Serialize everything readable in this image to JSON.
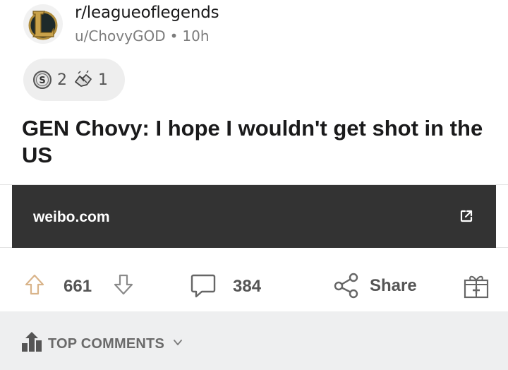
{
  "post": {
    "subreddit": "r/leagueoflegends",
    "author": "u/ChovyGOD",
    "separator": "•",
    "age": "10h",
    "title": "GEN Chovy: I hope I wouldn't get shot in the US",
    "link_domain": "weibo.com"
  },
  "awards": [
    {
      "icon": "silver-award-icon",
      "count": "2"
    },
    {
      "icon": "helpful-hands-award-icon",
      "count": "1"
    }
  ],
  "actions": {
    "score": "661",
    "comments": "384",
    "share_label": "Share"
  },
  "comments_sort": {
    "label": "TOP COMMENTS"
  },
  "colors": {
    "link_card_bg": "#333333",
    "comments_bar_bg": "#eeeff0",
    "upvote_accent": "#d9b48a"
  }
}
